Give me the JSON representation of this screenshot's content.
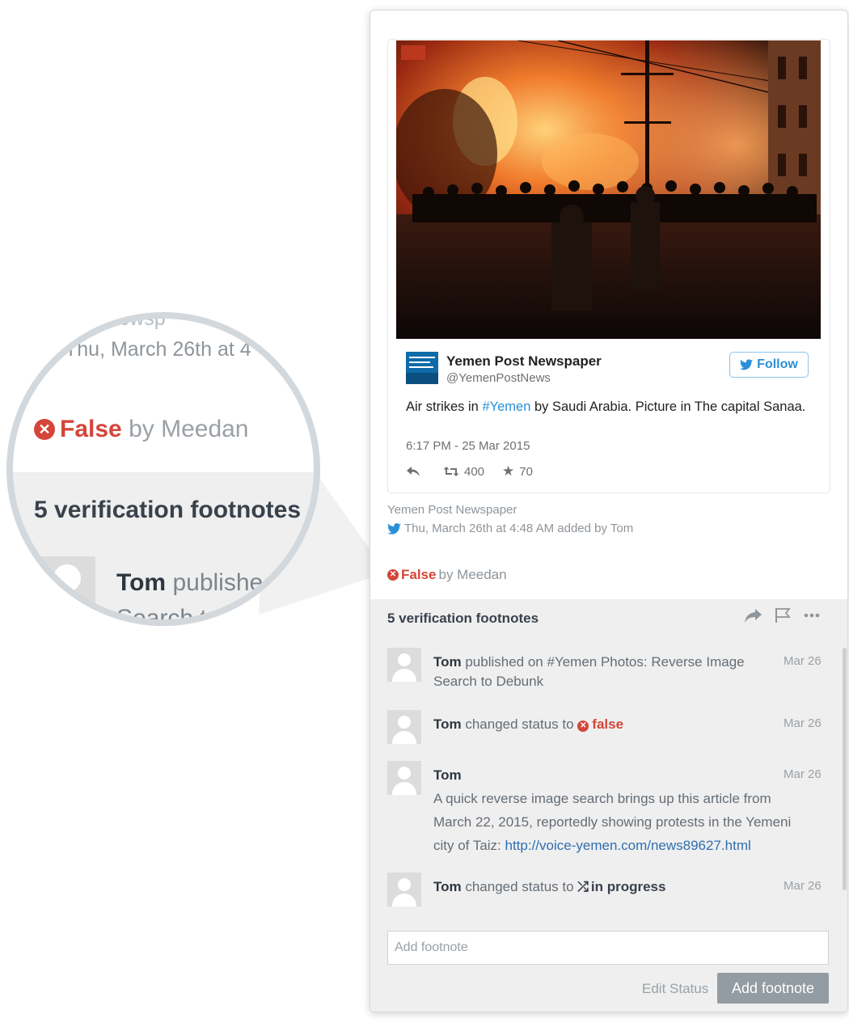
{
  "magnifier": {
    "source_fragment": "ost Newsp",
    "date_fragment": "Thu, March 26th at 4",
    "status_false": "False",
    "status_by": "by Meedan",
    "footnote_count": "5 verification footnotes",
    "user": "Tom",
    "action_fragment": "publishe",
    "search_fragment": "Search t"
  },
  "tweet": {
    "author_name": "Yemen Post Newspaper",
    "handle": "@YemenPostNews",
    "follow_label": "Follow",
    "text_before": "Air strikes in ",
    "hashtag": "#Yemen",
    "text_after": " by Saudi Arabia. Picture in The capital Sanaa.",
    "time": "6:17 PM - 25 Mar 2015",
    "retweets": "400",
    "favorites": "70",
    "logo_text": "YEMEN POST"
  },
  "source": {
    "name": "Yemen Post Newspaper",
    "added": "Thu, March 26th at 4:48 AM added by Tom"
  },
  "status": {
    "value": "False",
    "by": "by Meedan"
  },
  "footnotes": {
    "title": "5 verification footnotes",
    "items": [
      {
        "user": "Tom",
        "text": " published on #Yemen Photos: Reverse Image Search to Debunk",
        "date": "Mar 26"
      },
      {
        "user": "Tom",
        "text": " changed status to ",
        "status": "false",
        "date": "Mar 26"
      },
      {
        "user": "Tom",
        "comment": "A quick reverse image search brings up this article from March 22, 2015, reportedly showing protests in the Yemeni city of Taiz: ",
        "link": "http://voice-yemen.com/news89627.html",
        "date": "Mar 26"
      },
      {
        "user": "Tom",
        "text": " changed status to ",
        "status": "in progress",
        "date": "Mar 26"
      }
    ],
    "input_placeholder": "Add footnote",
    "edit_status_label": "Edit Status",
    "add_button_label": "Add footnote"
  },
  "colors": {
    "false_red": "#d4453a",
    "twitter_blue": "#2b8fd9",
    "link_blue": "#2f6fb0",
    "footnote_bg": "#efefef",
    "button_gray": "#939ba3"
  }
}
